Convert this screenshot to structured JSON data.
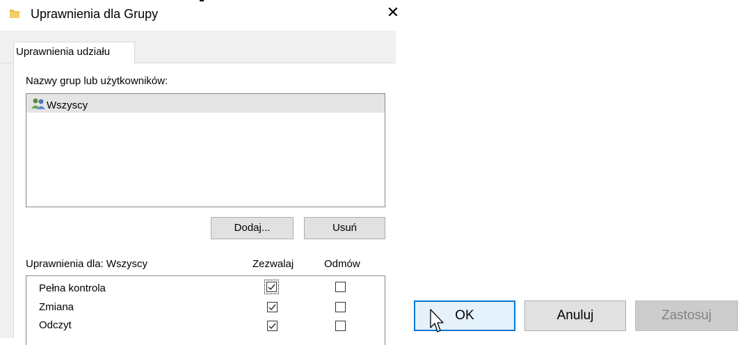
{
  "window": {
    "title": "Uprawnienia dla Grupy",
    "close_symbol": "✕",
    "icons": {
      "title": "folder-icon",
      "close": "close-icon"
    }
  },
  "tabs": [
    {
      "label": "Uprawnienia udziału",
      "selected": true
    }
  ],
  "groups": {
    "label": "Nazwy grup lub użytkowników:",
    "items": [
      {
        "name": "Wszyscy",
        "icon": "users-group-icon",
        "selected": true
      }
    ],
    "add_label": "Dodaj...",
    "remove_label": "Usuń"
  },
  "permissions": {
    "label": "Uprawnienia dla: Wszyscy",
    "allow_header": "Zezwalaj",
    "deny_header": "Odmów",
    "rows": [
      {
        "name": "Pełna kontrola",
        "allow": true,
        "deny": false
      },
      {
        "name": "Zmiana",
        "allow": true,
        "deny": false
      },
      {
        "name": "Odczyt",
        "allow": true,
        "deny": false
      }
    ]
  },
  "buttons": {
    "ok": "OK",
    "cancel": "Anuluj",
    "apply": "Zastosuj",
    "apply_enabled": false
  },
  "colors": {
    "accent": "#0078d7",
    "selection": "#e5e5e5",
    "dialog_bg": "#f0f0f0"
  }
}
